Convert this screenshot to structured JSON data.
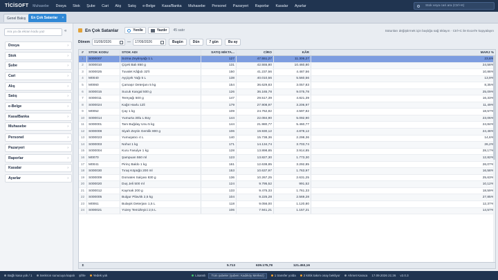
{
  "app": {
    "logo": "TİCİSOFT",
    "subtitle": "Muhasebe",
    "menu": [
      "Dosya",
      "Stok",
      "Şube",
      "Cari",
      "Alış",
      "Satış",
      "e-Belge",
      "Kasa/Banka",
      "Muhasebe",
      "Personel",
      "Pazaryeri",
      "Raporlar",
      "Kasalar",
      "Ayarlar"
    ],
    "search_placeholder": "Stok veya cari ara (Ctrl+K)"
  },
  "tabs": [
    {
      "label": "Genel Bakış"
    },
    {
      "label": "En Çok Satanlar",
      "close": "×"
    }
  ],
  "sidebar": {
    "search_placeholder": "Ara ya da ekran kodu yaz",
    "collapse": "«",
    "items": [
      "Dosya",
      "Stok",
      "Şube",
      "Cari",
      "Alış",
      "Satış",
      "e-Belge",
      "Kasa/Banka",
      "Muhasebe",
      "Personel",
      "Pazaryeri",
      "Raporlar",
      "Kasalar",
      "Ayarlar"
    ],
    "chevron": "›"
  },
  "toolbar": {
    "title": "En Çok Satanlar",
    "refresh": "Yenile",
    "print": "Yazdır",
    "count": "45 satır",
    "hint": "Sütunları değiştirmek için başlığa sağ tıklayın · Ctrl+C ile Excel'e kopyalayın"
  },
  "filter": {
    "label": "Dönem",
    "from": "01/09/2026",
    "to": "17/09/2026",
    "sep": "—",
    "buttons": [
      "Bugün",
      "Dün",
      "7 gün",
      "Bu ay"
    ]
  },
  "table": {
    "headers": [
      "#",
      "STOK KODU",
      "STOK ADI",
      "SATIŞ MİKTA...",
      "CİRO",
      "KÂR",
      "MARJ %"
    ],
    "rows": [
      [
        "1",
        "S000007",
        "Sızma Zeytinyağı 1 L",
        "127",
        "47.551,27",
        "11.306,27",
        "23,8%"
      ],
      [
        "2",
        "S000010",
        "Çiçek Balı 850 g",
        "131",
        "42.555,80",
        "10.460,80",
        "24,58%"
      ],
      [
        "3",
        "S000025",
        "Tuvalet Kâğıdı 32'li",
        "150",
        "41.237,56",
        "4.487,56",
        "10,88%"
      ],
      [
        "4",
        "M0040",
        "Ayçiçek Yağı 5 L",
        "138",
        "40.010,56",
        "5.560,56",
        "13,9%"
      ],
      [
        "5",
        "M0060",
        "Çamaşır Deterjanı 5 kg",
        "154",
        "36.629,83",
        "3.057,83",
        "8,35%"
      ],
      [
        "6",
        "S000015",
        "Sucuk Kangal 500 g",
        "126",
        "36.165,78",
        "9.075,78",
        "25,09%"
      ],
      [
        "7",
        "S000011",
        "Tereyağı 500 g",
        "147",
        "29.517,39",
        "4.821,39",
        "16,33%"
      ],
      [
        "8",
        "S000024",
        "Kağıt Havlu 12li",
        "179",
        "27.908,97",
        "3.206,97",
        "11,49%"
      ],
      [
        "9",
        "M0052",
        "Çay 1 kg",
        "109",
        "24.762,82",
        "4.597,82",
        "18,57%"
      ],
      [
        "10",
        "S000014",
        "Yumurta 30lu L Boy",
        "144",
        "22.084,90",
        "5.092,90",
        "23,06%"
      ],
      [
        "11",
        "S000001",
        "Tam Buğday Unu 5 kg",
        "144",
        "21.980,77",
        "5.460,77",
        "24,84%"
      ],
      [
        "12",
        "S000008",
        "Siyah Zeytin Gemlik 800 g",
        "106",
        "19.930,12",
        "4.878,12",
        "24,48%"
      ],
      [
        "13",
        "S000023",
        "Yumuşatıcı 4 L",
        "140",
        "15.738,36",
        "2.298,36",
        "14,6%"
      ],
      [
        "14",
        "S000003",
        "Nohut 1 kg",
        "171",
        "14.134,74",
        "3.703,74",
        "26,2%"
      ],
      [
        "15",
        "S000004",
        "Kuru Fasulye 1 kg",
        "128",
        "13.898,85",
        "3.914,85",
        "28,17%"
      ],
      [
        "16",
        "M0070",
        "Şampuan 550 ml",
        "123",
        "13.827,30",
        "1.773,30",
        "12,82%"
      ],
      [
        "17",
        "M0041",
        "Pirinç Baldo 1 kg",
        "161",
        "12.638,85",
        "3.292,85",
        "26,07%"
      ],
      [
        "18",
        "S000030",
        "Tıraş Köpüğü 200 ml",
        "153",
        "10.637,97",
        "1.763,97",
        "16,58%"
      ],
      [
        "19",
        "S000009",
        "Domates Salçası 830 g",
        "136",
        "10.267,25",
        "2.631,25",
        "25,63%"
      ],
      [
        "20",
        "S000020",
        "Duş Jeli 500 ml",
        "124",
        "9.795,52",
        "991,52",
        "10,12%"
      ],
      [
        "21",
        "S000012",
        "Kaymak 200 g",
        "133",
        "9.475,33",
        "1.761,33",
        "18,59%"
      ],
      [
        "22",
        "S000005",
        "Bulgur Pilavlık 2,5 kg",
        "104",
        "9.225,28",
        "2.569,28",
        "27,85%"
      ],
      [
        "23",
        "M0061",
        "Bulaşık Deterjanı 1,5 L",
        "118",
        "9.056,00",
        "1.120,80",
        "12,37%"
      ],
      [
        "24",
        "S000021",
        "Yüzey Temizleyici 2,5 L",
        "106",
        "7.941,21",
        "1.157,21",
        "14,57%"
      ]
    ],
    "selected_row": 0,
    "footer": {
      "label": "Σ",
      "qty": "5.713",
      "ciro": "639.175,78",
      "kar": "121.453,16"
    }
  },
  "status": {
    "items": [
      "Bağlı kasa yok / 1",
      "Senkron sunucuya kapalı",
      "şifrle",
      "Yedek yok"
    ],
    "license": "Lisanslı",
    "branch": "Tüm şubeler (şuben: Kadıköy Merkez)",
    "transfers": "1 transfer yolda",
    "alerts": "2 kritik takım onay bekliyor",
    "user": "Ahmet Karaca",
    "datetime": "17.09.2026 21:26",
    "version": "v2.0.3"
  },
  "colors": {
    "topbar": "#203450",
    "accent": "#2f88d6",
    "selected_row": "#7d9de0"
  }
}
